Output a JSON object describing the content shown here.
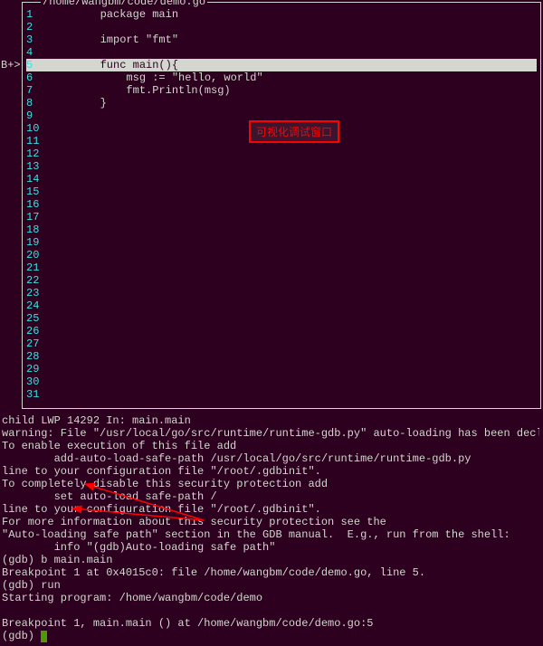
{
  "source": {
    "title": "/home/wangbm/code/demo.go",
    "breakpoint_marker": "B+>",
    "breakpoint_line": 5,
    "lines": [
      {
        "num": 1,
        "code": "        package main"
      },
      {
        "num": 2,
        "code": ""
      },
      {
        "num": 3,
        "code": "        import \"fmt\""
      },
      {
        "num": 4,
        "code": ""
      },
      {
        "num": 5,
        "code": "        func main(){",
        "highlight": true
      },
      {
        "num": 6,
        "code": "            msg := \"hello, world\""
      },
      {
        "num": 7,
        "code": "            fmt.Println(msg)"
      },
      {
        "num": 8,
        "code": "        }"
      },
      {
        "num": 9,
        "code": ""
      },
      {
        "num": 10,
        "code": ""
      },
      {
        "num": 11,
        "code": ""
      },
      {
        "num": 12,
        "code": ""
      },
      {
        "num": 13,
        "code": ""
      },
      {
        "num": 14,
        "code": ""
      },
      {
        "num": 15,
        "code": ""
      },
      {
        "num": 16,
        "code": ""
      },
      {
        "num": 17,
        "code": ""
      },
      {
        "num": 18,
        "code": ""
      },
      {
        "num": 19,
        "code": ""
      },
      {
        "num": 20,
        "code": ""
      },
      {
        "num": 21,
        "code": ""
      },
      {
        "num": 22,
        "code": ""
      },
      {
        "num": 23,
        "code": ""
      },
      {
        "num": 24,
        "code": ""
      },
      {
        "num": 25,
        "code": ""
      },
      {
        "num": 26,
        "code": ""
      },
      {
        "num": 27,
        "code": ""
      },
      {
        "num": 28,
        "code": ""
      },
      {
        "num": 29,
        "code": ""
      },
      {
        "num": 30,
        "code": ""
      },
      {
        "num": 31,
        "code": ""
      }
    ]
  },
  "annotation": {
    "text": "可视化调试窗口"
  },
  "console": {
    "lines": [
      "child LWP 14292 In: main.main",
      "warning: File \"/usr/local/go/src/runtime/runtime-gdb.py\" auto-loading has been declined by your `a",
      "To enable execution of this file add",
      "        add-auto-load-safe-path /usr/local/go/src/runtime/runtime-gdb.py",
      "line to your configuration file \"/root/.gdbinit\".",
      "To completely disable this security protection add",
      "        set auto-load safe-path /",
      "line to your configuration file \"/root/.gdbinit\".",
      "For more information about this security protection see the",
      "\"Auto-loading safe path\" section in the GDB manual.  E.g., run from the shell:",
      "        info \"(gdb)Auto-loading safe path\"",
      "(gdb) b main.main",
      "Breakpoint 1 at 0x4015c0: file /home/wangbm/code/demo.go, line 5.",
      "(gdb) run",
      "Starting program: /home/wangbm/code/demo",
      "",
      "Breakpoint 1, main.main () at /home/wangbm/code/demo.go:5",
      "(gdb) "
    ]
  }
}
